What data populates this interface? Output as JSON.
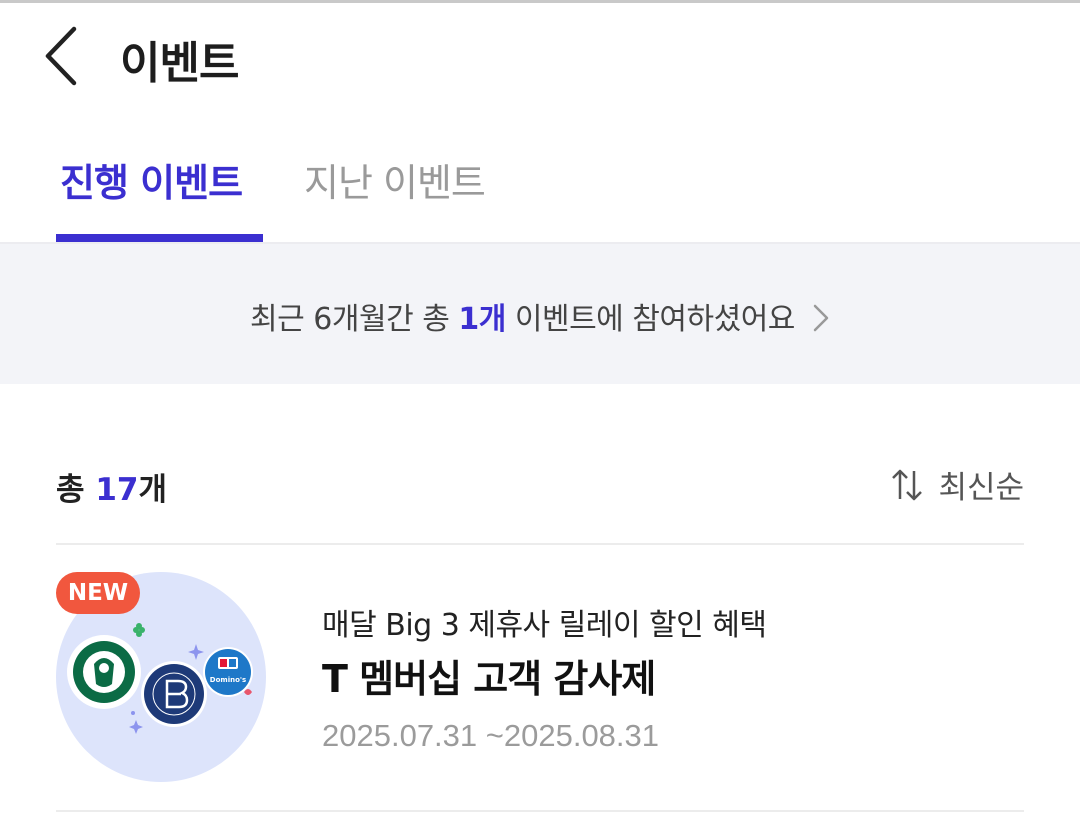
{
  "header": {
    "title": "이벤트"
  },
  "tabs": [
    {
      "label": "진행 이벤트",
      "active": true
    },
    {
      "label": "지난 이벤트",
      "active": false
    }
  ],
  "banner": {
    "prefix": "최근 6개월간 총 ",
    "highlight": "1개",
    "suffix": " 이벤트에 참여하셨어요"
  },
  "list": {
    "count_prefix": "총 ",
    "count_value": "17",
    "count_suffix": "개",
    "sort_label": "최신순"
  },
  "events": [
    {
      "badge": "NEW",
      "subtitle": "매달 Big 3 제휴사 릴레이 할인 혜택",
      "title": "T 멤버십 고객 감사제",
      "date": "2025.07.31 ~2025.08.31",
      "thumb_brands": [
        "starbucks-logo",
        "paris-baguette-logo",
        "dominos-logo"
      ]
    }
  ],
  "colors": {
    "accent": "#3b2fd0",
    "badge": "#f1573e",
    "banner_bg": "#f3f4f8"
  }
}
